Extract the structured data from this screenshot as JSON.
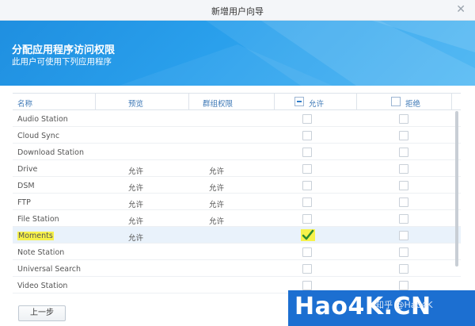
{
  "dialog": {
    "title": "新增用户向导",
    "close_icon": "close-icon"
  },
  "banner": {
    "heading": "分配应用程序访问权限",
    "subheading": "此用户可使用下列应用程序"
  },
  "table": {
    "columns": {
      "name": "名称",
      "preview": "预览",
      "group": "群组权限",
      "allow": "允许",
      "deny": "拒绝"
    },
    "rows": [
      {
        "name": "Audio Station",
        "preview": "",
        "group": "",
        "allow": false
      },
      {
        "name": "Cloud Sync",
        "preview": "",
        "group": "",
        "allow": false
      },
      {
        "name": "Download Station",
        "preview": "",
        "group": "",
        "allow": false
      },
      {
        "name": "Drive",
        "preview": "允许",
        "group": "允许",
        "allow": false
      },
      {
        "name": "DSM",
        "preview": "允许",
        "group": "允许",
        "allow": false
      },
      {
        "name": "FTP",
        "preview": "允许",
        "group": "允许",
        "allow": false
      },
      {
        "name": "File Station",
        "preview": "允许",
        "group": "允许",
        "allow": false
      },
      {
        "name": "Moments",
        "preview": "允许",
        "group": "",
        "allow": true
      },
      {
        "name": "Note Station",
        "preview": "",
        "group": "",
        "allow": false
      },
      {
        "name": "Universal Search",
        "preview": "",
        "group": "",
        "allow": false
      },
      {
        "name": "Video Station",
        "preview": "",
        "group": "",
        "allow": false
      }
    ]
  },
  "footer": {
    "back_label": "上一步"
  },
  "watermark": {
    "logo": "Hao4K.CN",
    "text": "知乎 @Hao4K"
  },
  "colors": {
    "accent": "#2aa0ec",
    "header_text": "#3d78b6",
    "check": "#2e8b2e",
    "highlight": "#f7f24a"
  }
}
